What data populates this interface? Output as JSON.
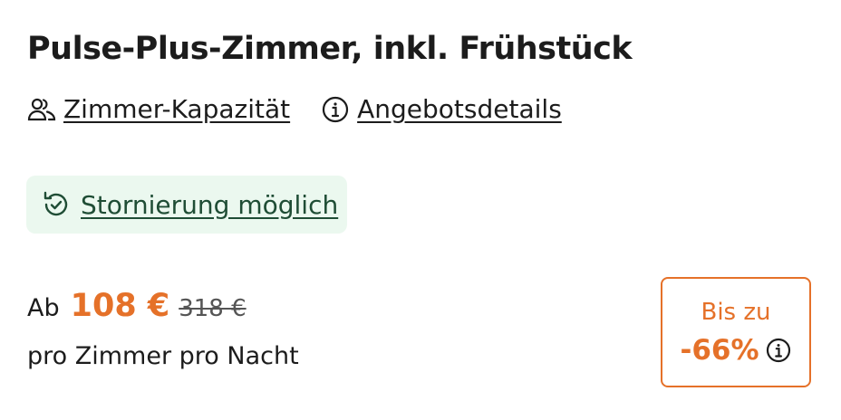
{
  "room": {
    "title": "Pulse-Plus-Zimmer, inkl. Frühstück",
    "links": {
      "capacity": "Zimmer-Kapazität",
      "offer_details": "Angebotsdetails"
    }
  },
  "cancellation": {
    "label": "Stornierung möglich"
  },
  "price": {
    "prefix": "Ab",
    "current": "108 €",
    "original": "318 €",
    "unit": "pro Zimmer pro Nacht"
  },
  "discount": {
    "label": "Bis zu",
    "value": "-66%"
  },
  "colors": {
    "accent": "#e57129",
    "success_bg": "#ebf8ef",
    "success_text": "#1f4d35"
  },
  "icons": {
    "capacity": "people-icon",
    "offer_details": "info-icon",
    "cancellation": "refresh-check-icon",
    "discount_info": "info-icon"
  }
}
